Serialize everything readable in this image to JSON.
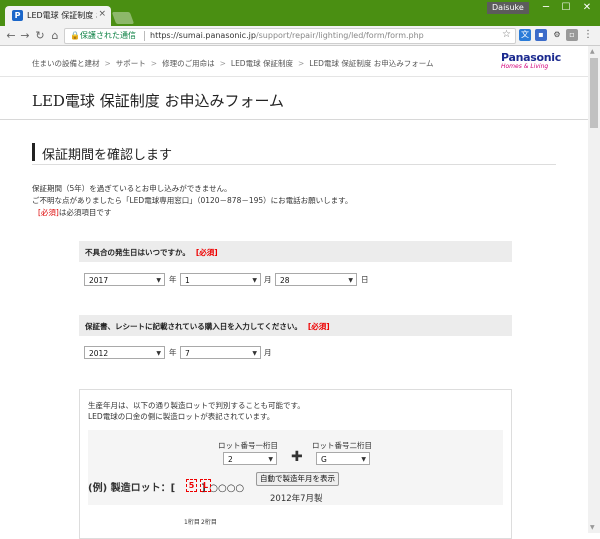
{
  "browser": {
    "tab_title": "LED電球 保証制度 お申込",
    "tab_favicon": "P",
    "tab_close": "×",
    "user": "Daisuke",
    "minimize": "─",
    "maximize": "☐",
    "close": "✕",
    "back": "←",
    "forward": "→",
    "reload": "↻",
    "home": "⌂",
    "secure_label": "保護された通信",
    "url_host": "https://sumai.panasonic.jp",
    "url_path": "/support/repair/lighting/led/form/form.php",
    "star": "☆",
    "menu": "⋮"
  },
  "header": {
    "breadcrumb": [
      "住まいの設備と建材",
      "サポート",
      "修理のご用命は",
      "LED電球 保証制度",
      "LED電球 保証制度 お申込みフォーム"
    ],
    "breadcrumb_sep": ">",
    "logo_main": "Panasonic",
    "logo_sub": "Homes & Living"
  },
  "page": {
    "title": "LED電球 保証制度 お申込みフォーム",
    "section_title": "保証期間を確認します",
    "info_line1": "保証期間（5年）を過ぎているとお申し込みができません。",
    "info_line2": "ご不明な点がありましたら「LED電球専用窓口」（0120－878－195）にお電話お願いします。",
    "required_mark": "[必須]",
    "required_note": "は必須項目です"
  },
  "q1": {
    "label": "不具合の発生日はいつですか。",
    "required": "[必須]",
    "year": "2017",
    "year_unit": "年",
    "month": "1",
    "month_unit": "月",
    "day": "28",
    "day_unit": "日"
  },
  "q2": {
    "label": "保証書、レシートに記載されている購入日を入力してください。",
    "required": "[必須]",
    "year": "2012",
    "year_unit": "年",
    "month": "7",
    "month_unit": "月"
  },
  "lot": {
    "text1": "生産年月は、以下の通り製造ロットで判別することも可能です。",
    "text2": "LED電球の口金の側に製造ロットが表記されています。",
    "label1": "ロット番号一桁目",
    "label2": "ロット番号二桁目",
    "value1": "2",
    "value2": "G",
    "plus": "✚",
    "button": "自動で製造年月を表示",
    "result": "2012年7月製",
    "example": "(例) 製造ロット：[",
    "digit1_label": "1桁目",
    "digit2_label": "2桁目",
    "digit1": "5",
    "digit2": "L",
    "example_tail": "] ○○○○"
  }
}
